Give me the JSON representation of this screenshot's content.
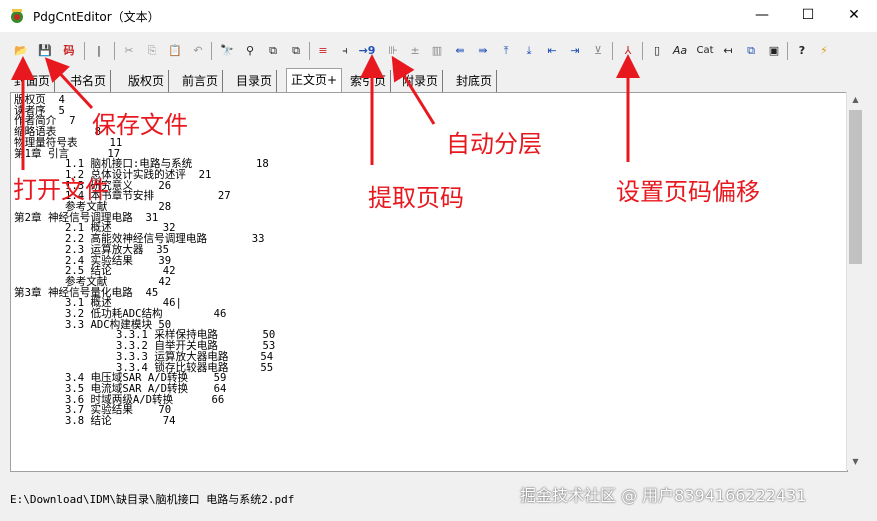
{
  "window": {
    "title": "PdgCntEditor（文本）",
    "minimize": "—",
    "maximize": "☐",
    "close": "✕"
  },
  "toolbar": {
    "open": "📂",
    "save": "💾",
    "ma": "码",
    "b1": "|",
    "cut": "✂",
    "copy": "⎘",
    "paste": "📋",
    "undo": "↶",
    "find": "🔭",
    "findnext": "⚲",
    "b2": "⧉",
    "b3": "⧉",
    "b4": "≡",
    "b5": "⫞",
    "extract": "→9",
    "auto": "⊪",
    "b6": "±",
    "b7": "▥",
    "b8": "⇚",
    "b9": "⇛",
    "b10": "⤒",
    "b11": "⤓",
    "b12": "⇤",
    "b13": "⇥",
    "b14": "⊻",
    "pdf": "⅄",
    "b15": "▯",
    "aa": "Aa",
    "cat": "Cat",
    "b16": "↤",
    "b17": "⧉",
    "b18": "▣",
    "help": "?",
    "b19": "⚡"
  },
  "tabs": [
    "封面页",
    "书名页",
    "版权页",
    "前言页",
    "目录页",
    "正文页+",
    "索引页",
    "附录页",
    "封底页"
  ],
  "editor_lines": [
    "版权页  4",
    "读者序  5",
    "作者简介  7",
    "缩略语表      8",
    "物理量符号表     11",
    "第1章 引言      17",
    "        1.1 脑机接口:电路与系统          18",
    "        1.2 总体设计实践的述评  21",
    "        1.3 研究意义    26",
    "        1.4 本书章节安排          27",
    "        参考文献        28",
    "第2章 神经信号调理电路  31",
    "        2.1 概述        32",
    "        2.2 高能效神经信号调理电路       33",
    "        2.3 运算放大器  35",
    "        2.4 实验结果    39",
    "        2.5 结论        42",
    "        参考文献        42",
    "第3章 神经信号量化电路  45",
    "        3.1 概述        46|",
    "        3.2 低功耗ADC结构        46",
    "        3.3 ADC构建模块 50",
    "                3.3.1 采样保持电路       50",
    "                3.3.2 自举开关电路       53",
    "                3.3.3 运算放大器电路     54",
    "                3.3.4 锁存比较器电路     55",
    "        3.4 电压域SAR A/D转换    59",
    "        3.5 电流域SAR A/D转换    64",
    "        3.6 时域两级A/D转换      66",
    "        3.7 实验结果    70",
    "        3.8 结论        74"
  ],
  "statusbar": {
    "path": "E:\\Download\\IDM\\缺目录\\脑机接口 电路与系统2.pdf"
  },
  "watermark": "掘金技术社区 @ 用户8394166222431",
  "annotations": {
    "save": "保存文件",
    "open": "打开文件",
    "extract": "提取页码",
    "auto": "自动分层",
    "offset": "设置页码偏移"
  },
  "colors": {
    "annotation": "#e8181f"
  }
}
